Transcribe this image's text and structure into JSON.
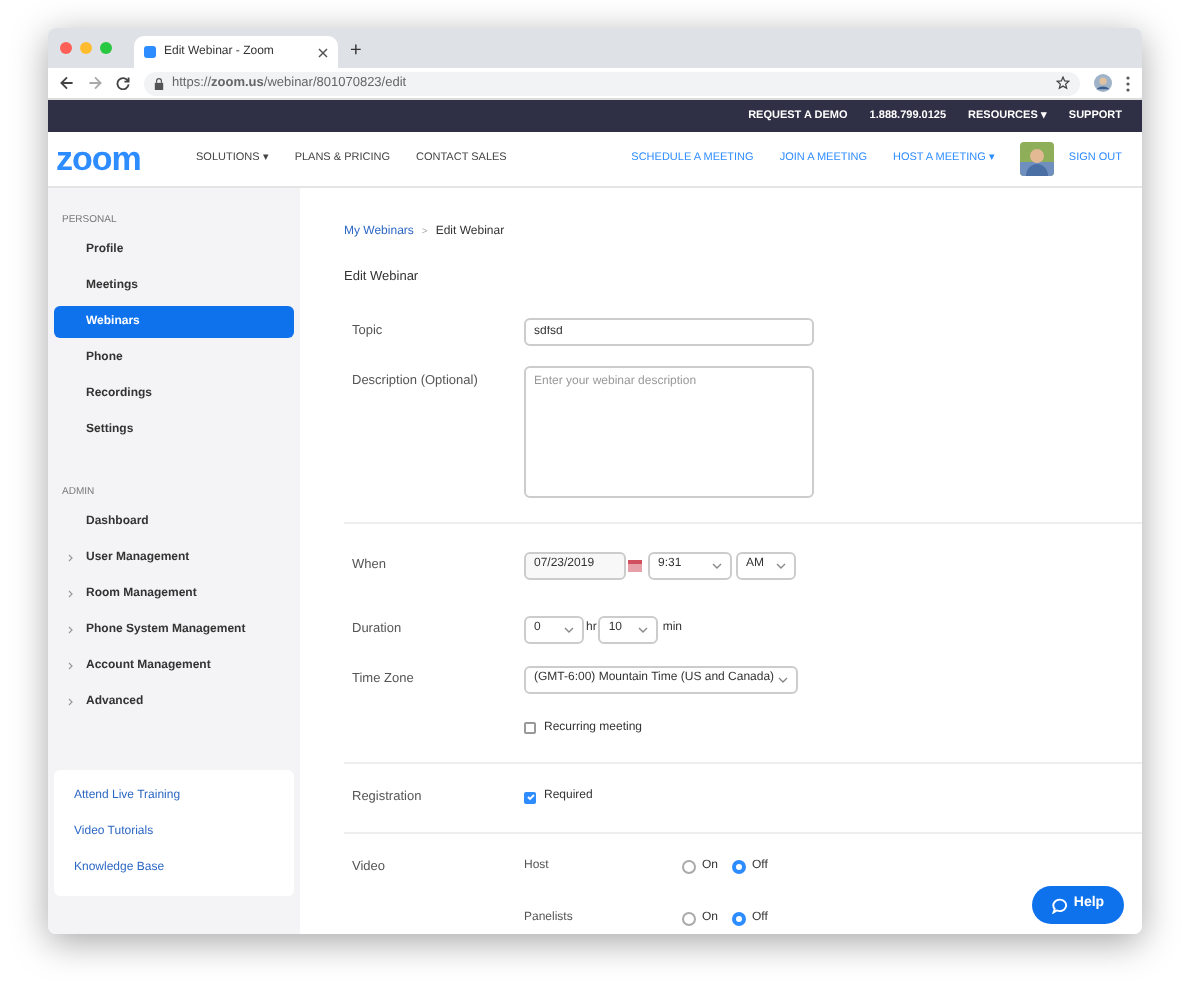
{
  "browser": {
    "tab_title": "Edit Webinar - Zoom",
    "new_tab": "+",
    "url": "https://**zoom.us**/webinar/801070823/edit"
  },
  "top_bar": [
    "REQUEST A DEMO",
    "1.888.799.0125",
    "RESOURCES ▾",
    "SUPPORT"
  ],
  "nav": {
    "logo": "zoom",
    "left": [
      "SOLUTIONS ▾",
      "PLANS & PRICING",
      "CONTACT SALES"
    ],
    "right": [
      "SCHEDULE A MEETING",
      "JOIN A MEETING",
      "HOST A MEETING ▾"
    ],
    "sign_out": "SIGN OUT"
  },
  "sidebar": {
    "sections": [
      {
        "title": "PERSONAL",
        "items": [
          {
            "label": "Profile",
            "selected": false,
            "expandable": false
          },
          {
            "label": "Meetings",
            "selected": false,
            "expandable": false
          },
          {
            "label": "Webinars",
            "selected": true,
            "expandable": false
          },
          {
            "label": "Phone",
            "selected": false,
            "expandable": false
          },
          {
            "label": "Recordings",
            "selected": false,
            "expandable": false
          },
          {
            "label": "Settings",
            "selected": false,
            "expandable": false
          }
        ]
      },
      {
        "title": "ADMIN",
        "items": [
          {
            "label": "Dashboard",
            "selected": false,
            "expandable": false
          },
          {
            "label": "User Management",
            "selected": false,
            "expandable": true
          },
          {
            "label": "Room Management",
            "selected": false,
            "expandable": true
          },
          {
            "label": "Phone System Management",
            "selected": false,
            "expandable": true
          },
          {
            "label": "Account Management",
            "selected": false,
            "expandable": true
          },
          {
            "label": "Advanced",
            "selected": false,
            "expandable": true
          }
        ]
      }
    ],
    "links": [
      "Attend Live Training",
      "Video Tutorials",
      "Knowledge Base"
    ]
  },
  "breadcrumb": {
    "link": "My Webinars",
    "separator": ">",
    "current": "Edit Webinar"
  },
  "heading": "Edit Webinar",
  "form": {
    "topic": {
      "label": "Topic",
      "value": "sdfsd"
    },
    "description": {
      "label": "Description (Optional)",
      "placeholder": "Enter your webinar description"
    },
    "when": {
      "label": "When",
      "date": "07/23/2019",
      "time": "9:31",
      "ampm": "AM"
    },
    "duration": {
      "label": "Duration",
      "hours": "0",
      "hours_unit": "hr",
      "minutes": "10",
      "minutes_unit": "min"
    },
    "time_zone": {
      "label": "Time Zone",
      "value": "(GMT-6:00) Mountain Time (US and Canada)"
    },
    "recurring": {
      "label": "Recurring meeting",
      "checked": false
    },
    "registration": {
      "label": "Registration",
      "option": "Required",
      "checked": true
    },
    "video": {
      "label": "Video",
      "rows": [
        {
          "label": "Host",
          "options": [
            {
              "label": "On",
              "selected": false
            },
            {
              "label": "Off",
              "selected": true
            }
          ]
        },
        {
          "label": "Panelists",
          "options": [
            {
              "label": "On",
              "selected": false
            },
            {
              "label": "Off",
              "selected": true
            }
          ]
        }
      ]
    }
  },
  "help_button": "Help"
}
